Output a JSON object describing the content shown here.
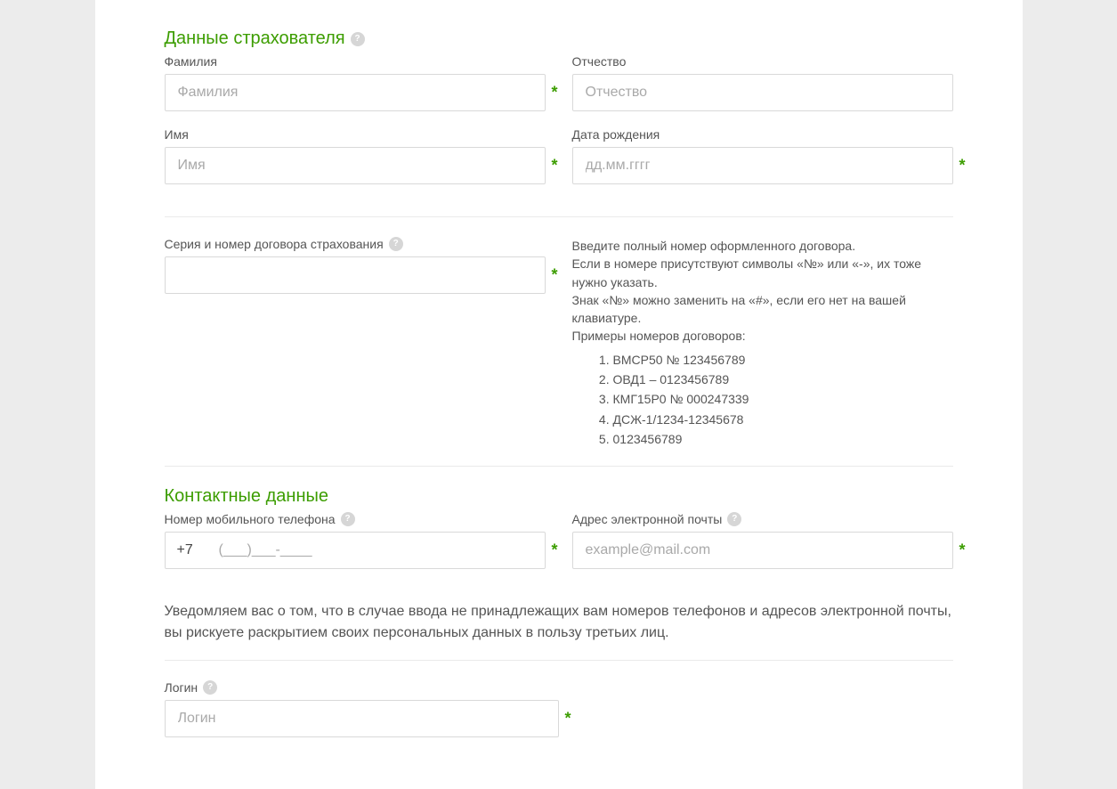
{
  "section1": {
    "title": "Данные страхователя"
  },
  "fields": {
    "lastName": {
      "label": "Фамилия",
      "placeholder": "Фамилия"
    },
    "patronymic": {
      "label": "Отчество",
      "placeholder": "Отчество"
    },
    "firstName": {
      "label": "Имя",
      "placeholder": "Имя"
    },
    "birthDate": {
      "label": "Дата рождения",
      "placeholder": "дд.мм.гггг"
    },
    "contract": {
      "label": "Серия и номер договора страхования",
      "placeholder": ""
    },
    "phone": {
      "label": "Номер мобильного телефона",
      "prefix": "+7",
      "placeholder": "(___)___-____"
    },
    "email": {
      "label": "Адрес электронной почты",
      "placeholder": "example@mail.com"
    },
    "login": {
      "label": "Логин",
      "placeholder": "Логин"
    }
  },
  "contractHelp": {
    "line1": "Введите полный номер оформленного договора.",
    "line2": "Если в номере присутствуют символы «№» или «-», их тоже нужно указать.",
    "line3": "Знак «№» можно заменить на «#», если его нет на вашей клавиатуре.",
    "examplesTitle": "Примеры номеров договоров:",
    "examples": [
      "ВМСР50 № 123456789",
      "ОВД1 – 0123456789",
      "КМГ15Р0 № 000247339",
      "ДСЖ-1/1234-12345678",
      "0123456789"
    ]
  },
  "section2": {
    "title": "Контактные данные"
  },
  "warning": "Уведомляем вас о том, что в случае ввода не принадлежащих вам номеров телефонов и адресов электронной почты, вы рискуете раскрытием своих персональных данных в пользу третьих лиц."
}
